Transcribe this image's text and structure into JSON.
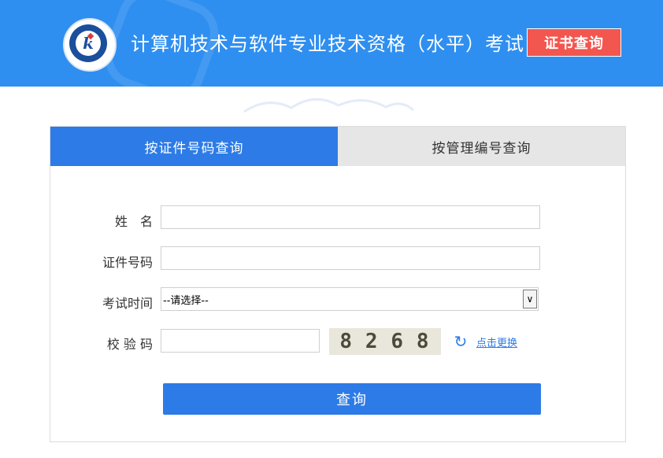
{
  "header": {
    "title": "计算机技术与软件专业技术资格（水平）考试",
    "cert_query_button": "证书查询",
    "logo_letter": "k",
    "bg_color": "#2f8ff0",
    "button_color": "#f2564e"
  },
  "tabs": [
    {
      "label": "按证件号码查询",
      "active": true
    },
    {
      "label": "按管理编号查询",
      "active": false
    }
  ],
  "form": {
    "name_label": "姓　名",
    "name_value": "",
    "id_label": "证件号码",
    "id_value": "",
    "exam_time_label": "考试时间",
    "exam_time_selected": "--请选择--",
    "captcha_label": "校 验 码",
    "captcha_value": "",
    "captcha_text": [
      "8",
      "2",
      "6",
      "8"
    ],
    "refresh_link": "点击更换",
    "submit_label": "查询"
  },
  "icons": {
    "refresh": "refresh-icon",
    "dropdown": "chevron-down-icon"
  }
}
